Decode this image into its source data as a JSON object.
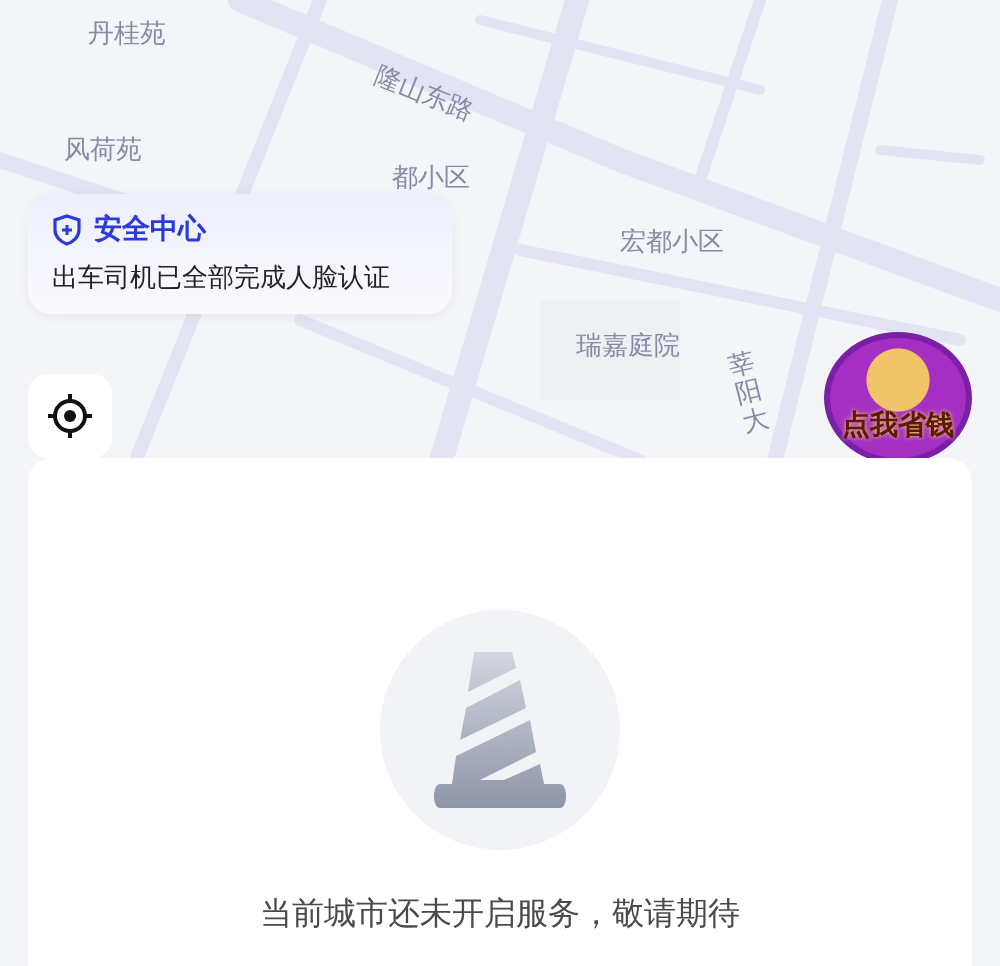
{
  "map": {
    "labels": [
      {
        "text": "丹桂苑",
        "kind": "place"
      },
      {
        "text": "风荷苑",
        "kind": "place"
      },
      {
        "text": "隆山东路",
        "kind": "road"
      },
      {
        "text": "都小区",
        "kind": "place"
      },
      {
        "text": "宏都小区",
        "kind": "place"
      },
      {
        "text": "瑞嘉庭院",
        "kind": "place"
      },
      {
        "text": "莘阳大",
        "kind": "vroad"
      }
    ]
  },
  "safety_card": {
    "title": "安全中心",
    "message": "出车司机已全部完成人脸认证"
  },
  "promo_badge": {
    "label": "点我省钱"
  },
  "notice": {
    "message": "当前城市还未开启服务，敬请期待"
  }
}
